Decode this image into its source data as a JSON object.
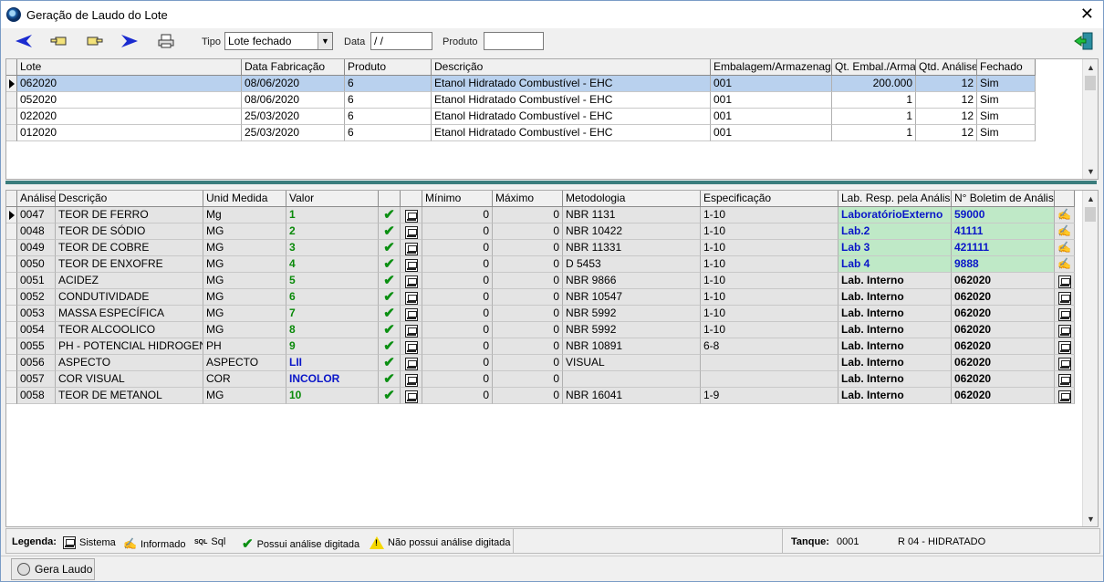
{
  "window": {
    "title": "Geração de Laudo do Lote"
  },
  "toolbar": {
    "tipo_label": "Tipo",
    "tipo_value": "Lote fechado",
    "data_label": "Data",
    "data_value": " / /",
    "produto_label": "Produto",
    "produto_value": ""
  },
  "lotes": {
    "columns": [
      "Lote",
      "Data Fabricação",
      "Produto",
      "Descrição",
      "Embalagem/Armazenagem",
      "Qt. Embal./Armaz.",
      "Qtd. Análises",
      "Fechado"
    ],
    "rows": [
      [
        "062020",
        "08/06/2020",
        "6",
        "Etanol Hidratado Combustível - EHC",
        "001",
        "200.000",
        "12",
        "Sim"
      ],
      [
        "052020",
        "08/06/2020",
        "6",
        "Etanol Hidratado Combustível - EHC",
        "001",
        "1",
        "12",
        "Sim"
      ],
      [
        "022020",
        "25/03/2020",
        "6",
        "Etanol Hidratado Combustível - EHC",
        "001",
        "1",
        "12",
        "Sim"
      ],
      [
        "012020",
        "25/03/2020",
        "6",
        "Etanol Hidratado Combustível - EHC",
        "001",
        "1",
        "12",
        "Sim"
      ]
    ]
  },
  "analises": {
    "columns": [
      "Análise",
      "Descrição",
      "Unid Medida",
      "Valor",
      "",
      "",
      "Mínimo",
      "Máximo",
      "Metodologia",
      "Especificação",
      "Lab. Resp. pela Análise",
      "N° Boletim de Análise",
      ""
    ],
    "rows": [
      {
        "cod": "0047",
        "desc": "TEOR DE FERRO",
        "unid": "Mg",
        "valor": "1",
        "min": "0",
        "max": "0",
        "metodo": "NBR 1131",
        "espec": "1-10",
        "lab": "LaboratórioExterno",
        "boletim": "59000"
      },
      {
        "cod": "0048",
        "desc": "TEOR DE SÓDIO",
        "unid": "MG",
        "valor": "2",
        "min": "0",
        "max": "0",
        "metodo": "NBR 10422",
        "espec": "1-10",
        "lab": "Lab.2",
        "boletim": "41111"
      },
      {
        "cod": "0049",
        "desc": "TEOR DE COBRE",
        "unid": "MG",
        "valor": "3",
        "min": "0",
        "max": "0",
        "metodo": "NBR 11331",
        "espec": "1-10",
        "lab": "Lab 3",
        "boletim": "421111"
      },
      {
        "cod": "0050",
        "desc": "TEOR DE ENXOFRE",
        "unid": "MG",
        "valor": "4",
        "min": "0",
        "max": "0",
        "metodo": "D 5453",
        "espec": "1-10",
        "lab": "Lab 4",
        "boletim": "9888"
      },
      {
        "cod": "0051",
        "desc": "ACIDEZ",
        "unid": "MG",
        "valor": "5",
        "min": "0",
        "max": "0",
        "metodo": "NBR 9866",
        "espec": "1-10",
        "lab": "Lab. Interno",
        "boletim": "062020"
      },
      {
        "cod": "0052",
        "desc": "CONDUTIVIDADE",
        "unid": "MG",
        "valor": "6",
        "min": "0",
        "max": "0",
        "metodo": "NBR 10547",
        "espec": "1-10",
        "lab": "Lab. Interno",
        "boletim": "062020"
      },
      {
        "cod": "0053",
        "desc": "MASSA ESPECÍFICA",
        "unid": "MG",
        "valor": "7",
        "min": "0",
        "max": "0",
        "metodo": "NBR 5992",
        "espec": "1-10",
        "lab": "Lab. Interno",
        "boletim": "062020"
      },
      {
        "cod": "0054",
        "desc": "TEOR ALCOOLICO",
        "unid": "MG",
        "valor": "8",
        "min": "0",
        "max": "0",
        "metodo": "NBR 5992",
        "espec": "1-10",
        "lab": "Lab. Interno",
        "boletim": "062020"
      },
      {
        "cod": "0055",
        "desc": "PH - POTENCIAL HIDROGENIONICO",
        "unid": "PH",
        "valor": "9",
        "min": "0",
        "max": "0",
        "metodo": "NBR 10891",
        "espec": "6-8",
        "lab": "Lab. Interno",
        "boletim": "062020"
      },
      {
        "cod": "0056",
        "desc": "ASPECTO",
        "unid": "ASPECTO",
        "valor": "LII",
        "min": "0",
        "max": "0",
        "metodo": "VISUAL",
        "espec": "",
        "lab": "Lab. Interno",
        "boletim": "062020"
      },
      {
        "cod": "0057",
        "desc": "COR VISUAL",
        "unid": "COR",
        "valor": "INCOLOR",
        "min": "0",
        "max": "0",
        "metodo": "",
        "espec": "",
        "lab": "Lab. Interno",
        "boletim": "062020"
      },
      {
        "cod": "0058",
        "desc": "TEOR DE METANOL",
        "unid": "MG",
        "valor": "10",
        "min": "0",
        "max": "0",
        "metodo": "NBR 16041",
        "espec": "1-9",
        "lab": "Lab. Interno",
        "boletim": "062020"
      }
    ]
  },
  "legend": {
    "title": "Legenda:",
    "sistema": "Sistema",
    "informado": "Informado",
    "sql_icon": "SQL",
    "sql": "Sql",
    "possui": "Possui análise digitada",
    "nao_possui": "Não possui análise digitada",
    "tanque_label": "Tanque:",
    "tanque_value": "0001",
    "tanque_desc": "R 04 - HIDRATADO"
  },
  "statusbar": {
    "gera_laudo": "Gera Laudo"
  },
  "colors": {
    "selected_row": "#b9d1ee",
    "external_lab": "#bfe9c7",
    "check": "#0b8f12",
    "blue_text": "#0a16c8"
  }
}
